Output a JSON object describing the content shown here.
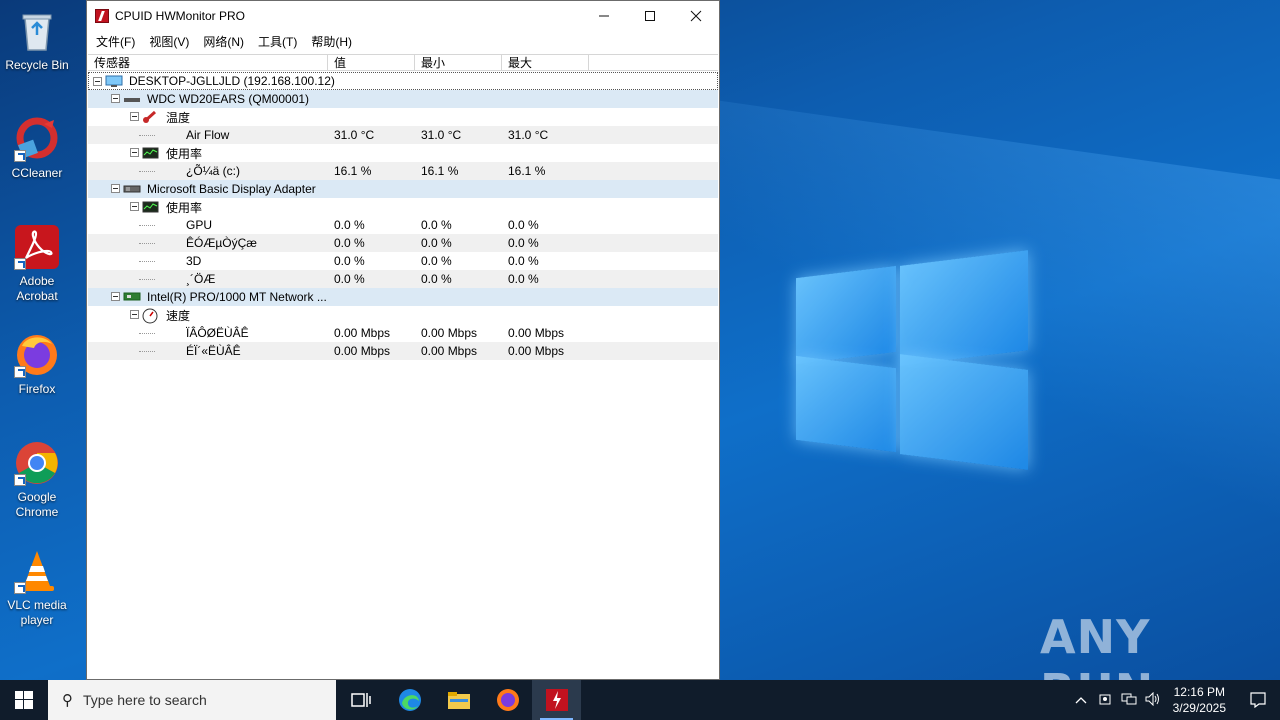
{
  "desktop": {
    "icons": [
      {
        "label": "Recycle Bin",
        "icon": "recycle-bin-icon"
      },
      {
        "label": "CCleaner",
        "icon": "ccleaner-icon"
      },
      {
        "label": "Adobe Acrobat",
        "icon": "acrobat-icon"
      },
      {
        "label": "Firefox",
        "icon": "firefox-icon"
      },
      {
        "label": "Google Chrome",
        "icon": "chrome-icon"
      },
      {
        "label": "VLC media player",
        "icon": "vlc-icon"
      }
    ],
    "watermark": "ANY RUN"
  },
  "window": {
    "title": "CPUID HWMonitor PRO",
    "menu": [
      "文件(F)",
      "视图(V)",
      "网络(N)",
      "工具(T)",
      "帮助(H)"
    ],
    "columns": [
      "传感器",
      "值",
      "最小",
      "最大"
    ],
    "rows": [
      {
        "level": 0,
        "kind": "host",
        "label": "DESKTOP-JGLLJLD (192.168.100.12)",
        "icon": "computer-icon"
      },
      {
        "level": 1,
        "kind": "device",
        "label": "WDC WD20EARS (QM00001)",
        "icon": "hard-drive-icon"
      },
      {
        "level": 2,
        "kind": "group",
        "label": "温度",
        "icon": "thermometer-icon"
      },
      {
        "level": 3,
        "kind": "sensor",
        "label": "Air Flow",
        "value": "31.0 °C",
        "min": "31.0 °C",
        "max": "31.0 °C"
      },
      {
        "level": 2,
        "kind": "group",
        "label": "使用率",
        "icon": "usage-chart-icon"
      },
      {
        "level": 3,
        "kind": "sensor",
        "label": "¿Õ¼ä (c:)",
        "value": "16.1 %",
        "min": "16.1 %",
        "max": "16.1 %"
      },
      {
        "level": 1,
        "kind": "device",
        "label": "Microsoft Basic Display Adapter",
        "icon": "display-adapter-icon"
      },
      {
        "level": 2,
        "kind": "group",
        "label": "使用率",
        "icon": "usage-chart-icon"
      },
      {
        "level": 3,
        "kind": "sensor",
        "label": "GPU",
        "value": "0.0 %",
        "min": "0.0 %",
        "max": "0.0 %"
      },
      {
        "level": 3,
        "kind": "sensor",
        "label": "ÊÓÆµÒýÇæ",
        "value": "0.0 %",
        "min": "0.0 %",
        "max": "0.0 %"
      },
      {
        "level": 3,
        "kind": "sensor",
        "label": "3D",
        "value": "0.0 %",
        "min": "0.0 %",
        "max": "0.0 %"
      },
      {
        "level": 3,
        "kind": "sensor",
        "label": "¸´ÖÆ",
        "value": "0.0 %",
        "min": "0.0 %",
        "max": "0.0 %"
      },
      {
        "level": 1,
        "kind": "device",
        "label": "Intel(R) PRO/1000 MT Network ...",
        "icon": "network-card-icon"
      },
      {
        "level": 2,
        "kind": "group",
        "label": "速度",
        "icon": "speedometer-icon"
      },
      {
        "level": 3,
        "kind": "sensor",
        "label": "ÏÂÔØËÙÂÊ",
        "value": "0.00 Mbps",
        "min": "0.00 Mbps",
        "max": "0.00 Mbps"
      },
      {
        "level": 3,
        "kind": "sensor",
        "label": "ÉÏ´«ËÙÂÊ",
        "value": "0.00 Mbps",
        "min": "0.00 Mbps",
        "max": "0.00 Mbps"
      }
    ]
  },
  "taskbar": {
    "search_placeholder": "Type here to search",
    "apps": [
      "task-view-icon",
      "edge-icon",
      "file-explorer-icon",
      "firefox-icon",
      "hwmonitor-icon"
    ],
    "time": "12:16 PM",
    "date": "3/29/2025"
  }
}
